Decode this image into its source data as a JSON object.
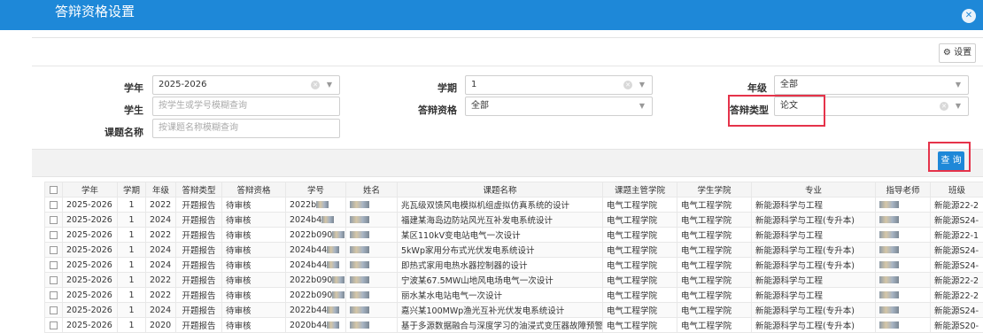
{
  "window": {
    "title": "答辩资格设置",
    "close_icon": "close-icon"
  },
  "toolbar": {
    "settings_label": "⚙ 设置"
  },
  "filters": {
    "year_label": "学年",
    "year_value": "2025-2026",
    "term_label": "学期",
    "term_value": "1",
    "grade_label": "年级",
    "grade_value": "全部",
    "student_label": "学生",
    "student_placeholder": "按学生或学号模糊查询",
    "qual_label": "答辩资格",
    "qual_value": "全部",
    "type_label": "答辩类型",
    "type_value": "论文",
    "topic_label": "课题名称",
    "topic_placeholder": "按课题名称模糊查询"
  },
  "actions": {
    "query_label": "查 询"
  },
  "table": {
    "headers": [
      "学年",
      "学期",
      "年级",
      "答辩类型",
      "答辩资格",
      "学号",
      "姓名",
      "课题名称",
      "课题主管学院",
      "学生学院",
      "专业",
      "指导老师",
      "班级"
    ],
    "rows": [
      [
        "2025-2026",
        "1",
        "2022",
        "开题报告",
        "待审核",
        "2022b",
        "",
        "兆瓦级双馈风电模拟机组虚拟仿真系统的设计",
        "电气工程学院",
        "电气工程学院",
        "新能源科学与工程",
        "",
        "新能源22-2"
      ],
      [
        "2025-2026",
        "1",
        "2024",
        "开题报告",
        "待审核",
        "2024b4",
        "",
        "福建某海岛边防站风光互补发电系统设计",
        "电气工程学院",
        "电气工程学院",
        "新能源科学与工程(专升本)",
        "",
        "新能源S24-"
      ],
      [
        "2025-2026",
        "1",
        "2022",
        "开题报告",
        "待审核",
        "2022b090",
        "",
        "某区110kV变电站电气一次设计",
        "电气工程学院",
        "电气工程学院",
        "新能源科学与工程",
        "",
        "新能源22-1"
      ],
      [
        "2025-2026",
        "1",
        "2024",
        "开题报告",
        "待审核",
        "2024b44",
        "",
        "5kWp家用分布式光伏发电系统设计",
        "电气工程学院",
        "电气工程学院",
        "新能源科学与工程(专升本)",
        "",
        "新能源S24-"
      ],
      [
        "2025-2026",
        "1",
        "2024",
        "开题报告",
        "待审核",
        "2024b44",
        "",
        "即热式家用电热水器控制器的设计",
        "电气工程学院",
        "电气工程学院",
        "新能源科学与工程(专升本)",
        "",
        "新能源S24-"
      ],
      [
        "2025-2026",
        "1",
        "2022",
        "开题报告",
        "待审核",
        "2022b090",
        "",
        "宁波某67.5MW山地风电场电气一次设计",
        "电气工程学院",
        "电气工程学院",
        "新能源科学与工程",
        "",
        "新能源22-2"
      ],
      [
        "2025-2026",
        "1",
        "2022",
        "开题报告",
        "待审核",
        "2022b090",
        "",
        "丽水某水电站电气一次设计",
        "电气工程学院",
        "电气工程学院",
        "新能源科学与工程",
        "",
        "新能源22-2"
      ],
      [
        "2025-2026",
        "1",
        "2024",
        "开题报告",
        "待审核",
        "2022b44",
        "",
        "嘉兴某100MWp渔光互补光伏发电系统设计",
        "电气工程学院",
        "电气工程学院",
        "新能源科学与工程(专升本)",
        "",
        "新能源S24-"
      ],
      [
        "2025-2026",
        "1",
        "2020",
        "开题报告",
        "待审核",
        "2020b44",
        "",
        "基于多源数据融合与深度学习的油浸式变压器故障预警及寿命",
        "电气工程学院",
        "电气工程学院",
        "新能源科学与工程(专升本)",
        "",
        "新能源S20-"
      ]
    ]
  },
  "colors": {
    "header_blue": "#1e88d8",
    "highlight_red": "#e5334a",
    "status_amber": "#c8960c"
  }
}
